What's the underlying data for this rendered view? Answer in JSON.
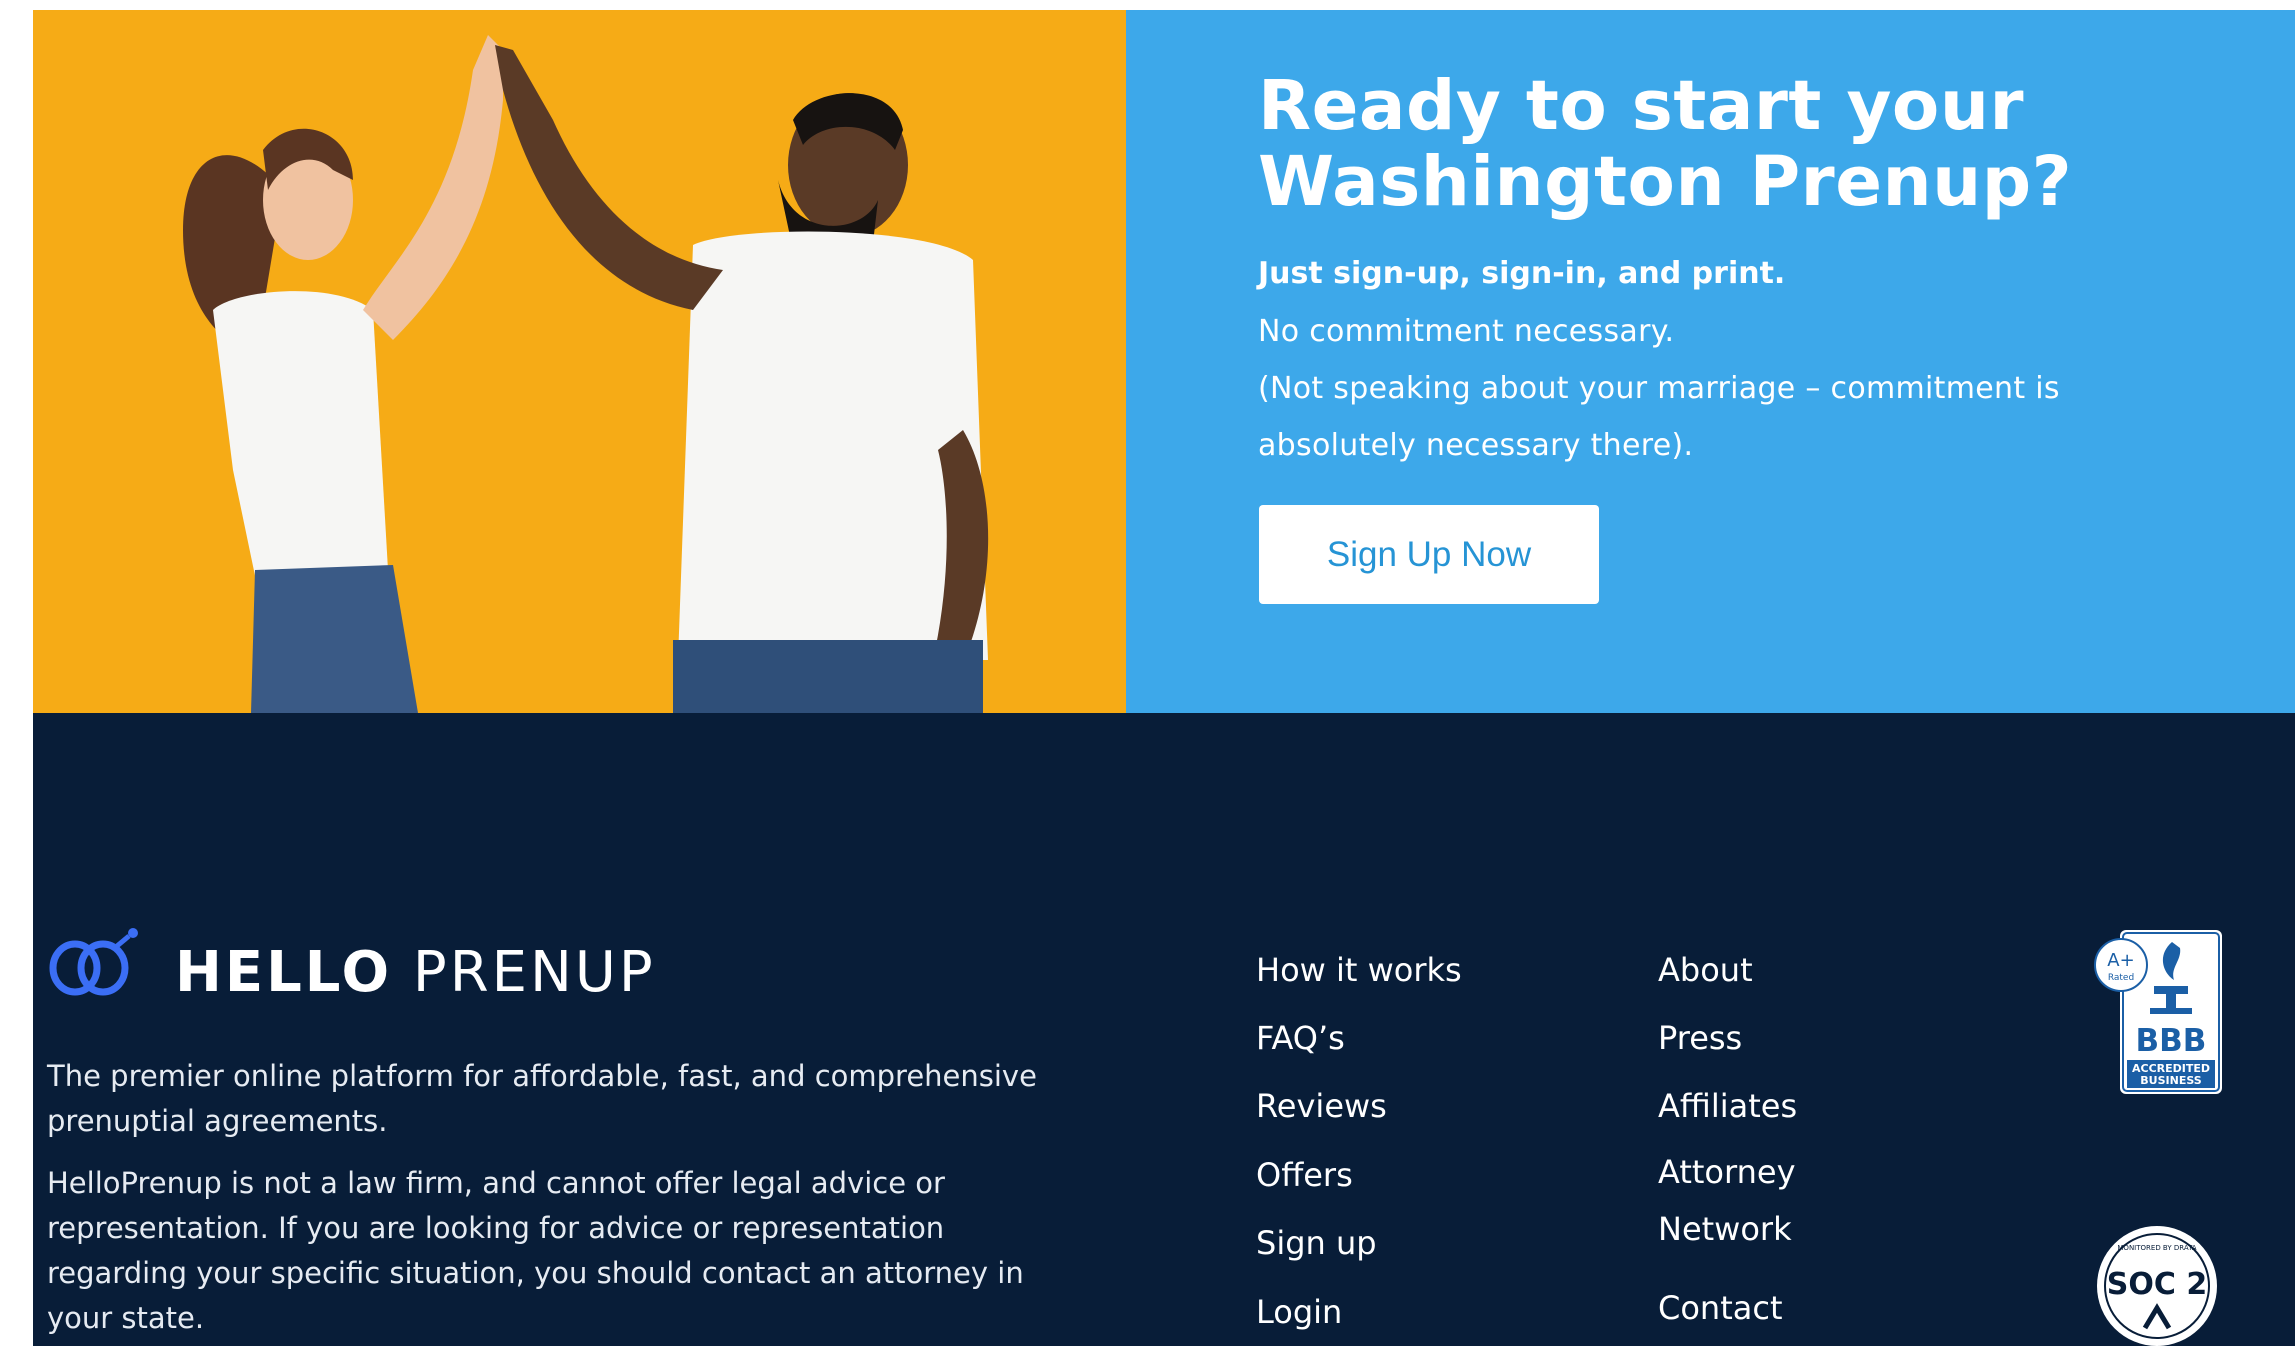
{
  "cta": {
    "title": "Ready to start your Washington Prenup?",
    "subtitle_bold": "Just sign-up, sign-in, and print.",
    "line1": "No commitment necessary.",
    "line2": "(Not speaking about your marriage – commitment is",
    "line3": "absolutely necessary there).",
    "button_label": "Sign Up Now",
    "colors": {
      "panel": "#3da8ea",
      "photo_bg": "#f6ab16",
      "button_text": "#2694d5"
    }
  },
  "footer": {
    "logo": {
      "hello": "HELLO",
      "prenup": "PRENUP"
    },
    "tagline": "The premier online platform for affordable, fast, and comprehensive prenuptial agreements.",
    "disclaimer": "HelloPrenup is not a law firm, and cannot offer legal advice or representation. If you are looking for advice or representation regarding your specific situation, you should contact an attorney in your state.",
    "nav_col1": [
      "How it works",
      "FAQ’s",
      "Reviews",
      "Offers",
      "Sign up",
      "Login"
    ],
    "nav_col2": [
      "About",
      "Press",
      "Affiliates",
      "Attorney Network",
      "Contact"
    ],
    "badges": {
      "bbb": {
        "rating": "A+",
        "rated": "Rated",
        "name": "BBB",
        "line1": "ACCREDITED",
        "line2": "BUSINESS"
      },
      "soc": {
        "label": "SOC 2",
        "ring": "MONITORED BY DRATA"
      }
    },
    "colors": {
      "background": "#081d38",
      "logo_accent": "#3b6ef5"
    }
  }
}
